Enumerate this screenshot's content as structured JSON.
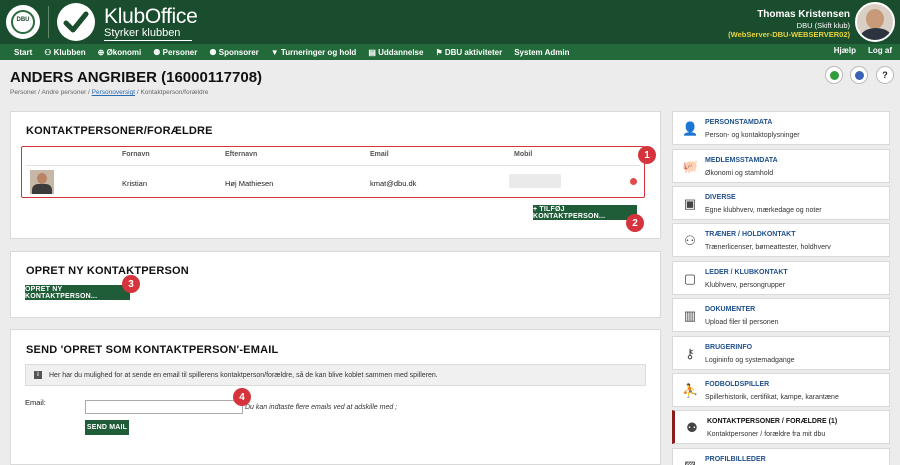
{
  "header": {
    "crest_text": "DBU",
    "brand_name": "KlubOffice",
    "slogan": "Styrker klubben",
    "user_name": "Thomas Kristensen",
    "user_club": "DBU (Skift klub)",
    "server": "(WebServer-DBU-WEBSERVER02)"
  },
  "nav": {
    "items": [
      "Start",
      "Klubben",
      "Økonomi",
      "Personer",
      "Sponsorer",
      "Turneringer og hold",
      "Uddannelse",
      "DBU aktiviteter",
      "System Admin"
    ],
    "help": "Hjælp",
    "logout": "Log af"
  },
  "page": {
    "title": "ANDERS ANGRIBER (16000117708)",
    "breadcrumb": [
      "Personer",
      "Andre personer",
      "Personoversigt",
      "Kontaktperson/forældre"
    ],
    "top_icons": [
      "refresh-icon",
      "info-icon",
      "help-icon"
    ]
  },
  "contacts_panel": {
    "title": "KONTAKTPERSONER/FORÆLDRE",
    "columns": [
      "Fornavn",
      "Efternavn",
      "Email",
      "Mobil"
    ],
    "rows": [
      {
        "first_name": "Kristian",
        "last_name": "Høj Mathiesen",
        "email": "kmat@dbu.dk",
        "mobile": ""
      }
    ],
    "add_button": "+ TILFØJ KONTAKTPERSON..."
  },
  "create_panel": {
    "title": "OPRET NY KONTAKTPERSON",
    "button": "OPRET NY KONTAKTPERSON..."
  },
  "email_panel": {
    "title": "SEND 'OPRET SOM KONTAKTPERSON'-EMAIL",
    "info_text": "Her har du mulighed for at sende en email til spillerens kontaktperson/forældre, så de kan blive koblet sammen med spilleren.",
    "email_label": "Email:",
    "email_value": "",
    "email_hint": "Du kan indtaste flere emails ved at adskille med ;",
    "send_button": "SEND MAIL"
  },
  "annotations": [
    "1",
    "2",
    "3",
    "4"
  ],
  "sidebar": [
    {
      "title": "PERSONSTAMDATA",
      "desc": "Person- og kontaktoplysninger",
      "icon": "person-icon"
    },
    {
      "title": "MEDLEMSSTAMDATA",
      "desc": "Økonomi og stamhold",
      "icon": "piggy-bank-icon"
    },
    {
      "title": "DIVERSE",
      "desc": "Egne klubhverv, mærkedage og noter",
      "icon": "box-icon"
    },
    {
      "title": "TRÆNER / HOLDKONTAKT",
      "desc": "Trænerlicenser, børneattester, holdhverv",
      "icon": "coach-icon"
    },
    {
      "title": "LEDER / KLUBKONTAKT",
      "desc": "Klubhverv, persongrupper",
      "icon": "badge-icon"
    },
    {
      "title": "DOKUMENTER",
      "desc": "Upload filer til personen",
      "icon": "documents-icon"
    },
    {
      "title": "BRUGERINFO",
      "desc": "Logininfo og systemadgange",
      "icon": "key-icon"
    },
    {
      "title": "FODBOLDSPILLER",
      "desc": "Spillerhistorik, certifikat, kampe, karantæne",
      "icon": "player-icon"
    },
    {
      "title": "KONTAKTPERSONER / FORÆLDRE (1)",
      "desc": "Kontaktpersoner / forældre fra mit dbu",
      "icon": "parent-child-icon"
    },
    {
      "title": "PROFILBILLEDER",
      "desc": "",
      "icon": "photo-icon"
    }
  ]
}
